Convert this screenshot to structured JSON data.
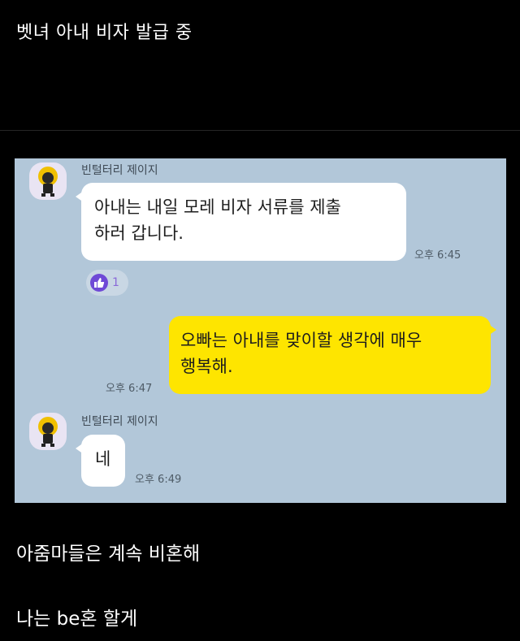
{
  "post": {
    "title": "벳녀 아내 비자 발급 중",
    "caption_line1": "아줌마들은 계속 비혼해",
    "caption_line2": "나는 be혼 할게"
  },
  "chat": {
    "background": "#b2c7d9",
    "messages": [
      {
        "sender": "빈털터리 제이지",
        "text_line1": "아내는 내일 모레 비자 서류를 제출",
        "text_line2": "하러 갑니다.",
        "time": "오후 6:45",
        "reaction": {
          "icon": "thumbs-up-icon",
          "count": "1"
        }
      },
      {
        "sender": "me",
        "text_line1": "오빠는 아내를 맞이할 생각에 매우",
        "text_line2": "행복해.",
        "time": "오후 6:47",
        "color": "#fee500"
      },
      {
        "sender": "빈털터리 제이지",
        "text_line1": "네",
        "time": "오후 6:49"
      }
    ]
  }
}
